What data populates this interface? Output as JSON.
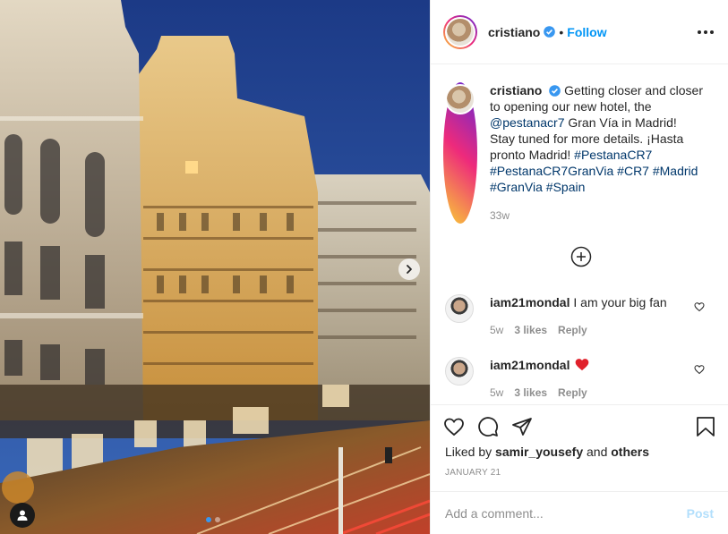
{
  "post": {
    "author": "cristiano",
    "follow_label": "Follow",
    "dot_separator": "•",
    "caption": {
      "username": "cristiano",
      "parts": [
        {
          "text": "Getting closer and closer to opening our new hotel, the ",
          "link": false
        },
        {
          "text": "@pestanacr7",
          "link": true
        },
        {
          "text": " Gran Vía in Madrid! Stay tuned for more details. ¡Hasta pronto Madrid! ",
          "link": false
        },
        {
          "text": "#PestanaCR7",
          "link": true
        },
        {
          "text": " ",
          "link": false
        },
        {
          "text": "#PestanaCR7GranVia",
          "link": true
        },
        {
          "text": " ",
          "link": false
        },
        {
          "text": "#CR7",
          "link": true
        },
        {
          "text": " ",
          "link": false
        },
        {
          "text": "#Madrid",
          "link": true
        },
        {
          "text": " ",
          "link": false
        },
        {
          "text": "#GranVia",
          "link": true
        },
        {
          "text": " ",
          "link": false
        },
        {
          "text": "#Spain",
          "link": true
        }
      ],
      "time": "33w"
    },
    "comments": [
      {
        "username": "iam21mondal",
        "text": "I am your big fan",
        "time": "5w",
        "likes": "3 likes",
        "reply": "Reply",
        "has_heart_emoji": false
      },
      {
        "username": "iam21mondal",
        "text": "",
        "time": "5w",
        "likes": "3 likes",
        "reply": "Reply",
        "has_heart_emoji": true
      }
    ],
    "liked_by": {
      "prefix": "Liked by",
      "user": "samir_yousefy",
      "conj": "and",
      "others": "others"
    },
    "date": "JANUARY 21",
    "add_comment": {
      "placeholder": "Add a comment...",
      "post_label": "Post"
    }
  },
  "carousel": {
    "slides": 2,
    "active": 0
  },
  "colors": {
    "accent": "#0095f6",
    "link": "#00376b",
    "muted": "#8e8e8e",
    "verified": "#3897f0",
    "heart": "#ed4956"
  },
  "icons": [
    "verified-badge-icon",
    "more-options-icon",
    "plus-circle-icon",
    "heart-outline-icon",
    "comment-icon",
    "share-icon",
    "bookmark-icon",
    "chevron-right-icon",
    "user-tag-icon",
    "red-heart-emoji-icon"
  ]
}
